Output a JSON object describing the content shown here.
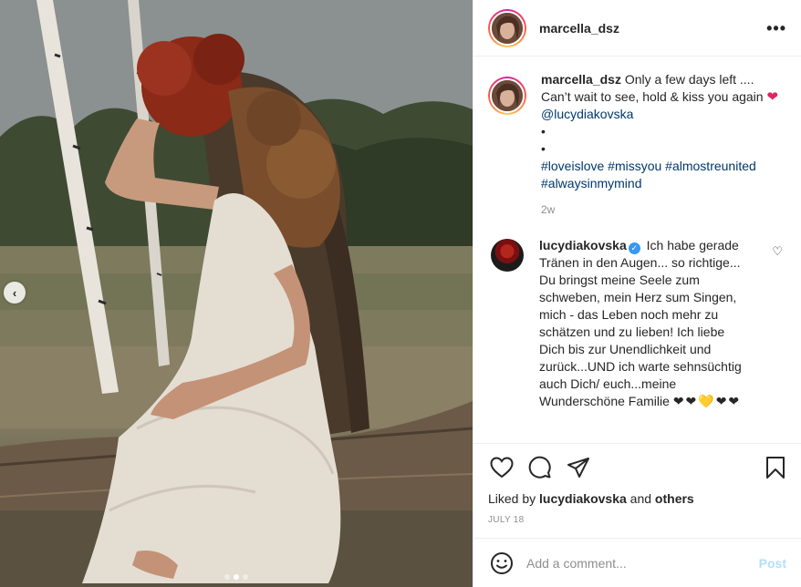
{
  "post": {
    "username": "marcella_dsz",
    "more_label": "•••",
    "carousel_prev_label": "‹",
    "carousel": {
      "total": 3,
      "active_index": 1
    }
  },
  "caption": {
    "username": "marcella_dsz",
    "text_1": "Only a few days left .... Can’t wait to see, hold & kiss you again",
    "heart": "❤",
    "mention": "@lucydiakovska",
    "bullet_1": "•",
    "bullet_2": "•",
    "hashtags_line1": "#loveislove #missyou #almostreunited",
    "hashtags_line2": "#alwaysinmymind",
    "time": "2w"
  },
  "comment": {
    "username": "lucydiakovska",
    "verified_glyph": "✓",
    "text": "Ich habe gerade Tränen in den Augen... so richtige... Du bringst meine Seele zum schweben, mein Herz sum Singen, mich - das Leben noch mehr zu schätzen und zu lieben! Ich liebe Dich bis zur Unendlichkeit und zurück...UND ich warte sehnsüchtig auch Dich/ euch...meine Wunderschöne Familie",
    "emoji_tail": "❤❤💛❤❤",
    "like_glyph": "♡"
  },
  "actions": {
    "liked_by_prefix": "Liked by",
    "liked_by_user": "lucydiakovska",
    "liked_by_and": "and",
    "liked_by_others": "others",
    "date": "JULY 18"
  },
  "add_comment": {
    "placeholder": "Add a comment...",
    "post_label": "Post"
  },
  "icons": {
    "like": "heart-outline-icon",
    "comment": "speech-bubble-icon",
    "share": "paper-plane-icon",
    "save": "bookmark-icon",
    "emoji": "smiley-icon"
  },
  "colors": {
    "link": "#00376b",
    "verified": "#3897f0",
    "post_disabled": "#b2dffc",
    "muted": "#8e8e8e"
  }
}
